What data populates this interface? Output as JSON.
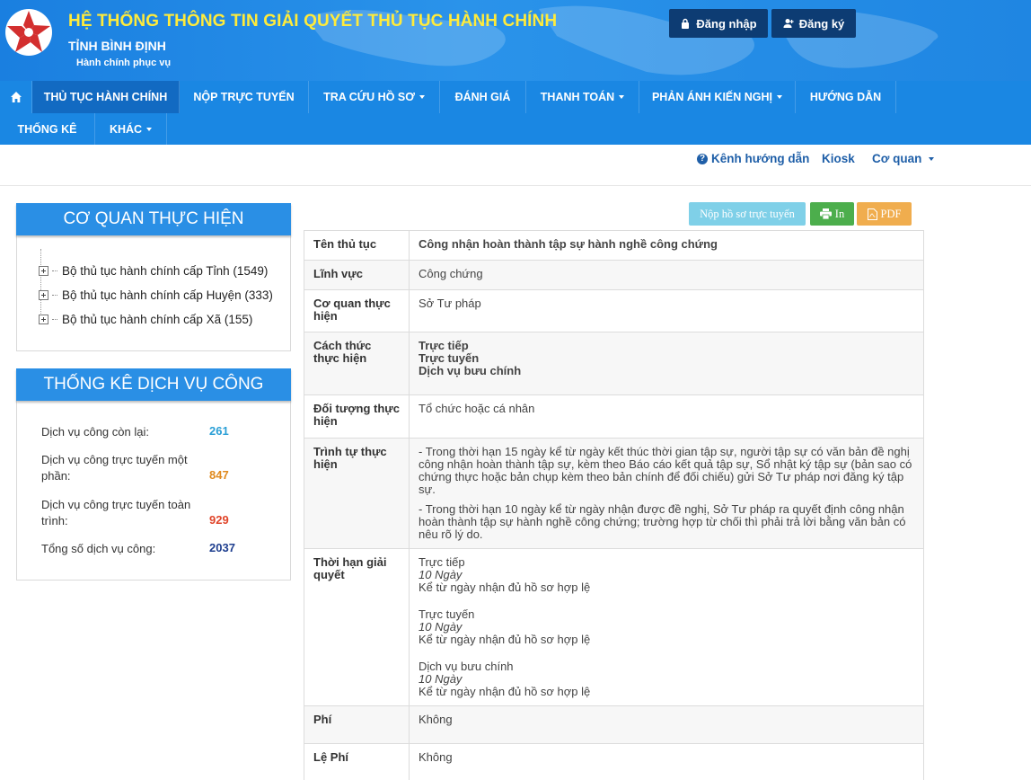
{
  "header": {
    "title": "HỆ THỐNG THÔNG TIN GIẢI QUYẾT THỦ TỤC HÀNH CHÍNH",
    "subtitle": "TỈNH BÌNH ĐỊNH",
    "slogan": "Hành chính phục vụ",
    "login_label": "Đăng nhập",
    "register_label": "Đăng ký"
  },
  "nav": {
    "items": [
      {
        "label": "THỦ TỤC HÀNH CHÍNH"
      },
      {
        "label": "NỘP TRỰC TUYẾN"
      },
      {
        "label": "TRA CỨU HỒ SƠ"
      },
      {
        "label": "ĐÁNH GIÁ"
      },
      {
        "label": "THANH TOÁN"
      },
      {
        "label": "PHẢN ÁNH KIẾN NGHỊ"
      },
      {
        "label": "HƯỚNG DẪN"
      },
      {
        "label": "THỐNG KÊ"
      },
      {
        "label": "KHÁC"
      }
    ]
  },
  "subnav": {
    "guide": "Kênh hướng dẫn",
    "kiosk": "Kiosk",
    "agency": "Cơ quan"
  },
  "agency_panel": {
    "title": "CƠ QUAN THỰC HIỆN",
    "items": [
      {
        "label": "Bộ thủ tục hành chính cấp Tỉnh (1549)"
      },
      {
        "label": "Bộ thủ tục hành chính cấp Huyện (333)"
      },
      {
        "label": "Bộ thủ tục hành chính cấp Xã (155)"
      }
    ]
  },
  "stats_panel": {
    "title": "THỐNG KÊ DỊCH VỤ CÔNG",
    "rows": [
      {
        "label": "Dịch vụ công còn lại:",
        "value": "261",
        "color": "#2a9fd6"
      },
      {
        "label": "Dịch vụ công trực tuyến một phần:",
        "value": "847",
        "color": "#e08a1e"
      },
      {
        "label": "Dịch vụ công trực tuyến toàn trình:",
        "value": "929",
        "color": "#e0452a"
      },
      {
        "label": "Tổng số dịch vụ công:",
        "value": "2037",
        "color": "#1f3f8f"
      }
    ]
  },
  "actions": {
    "submit": "Nộp hồ sơ trực tuyến",
    "print": "In",
    "pdf": "PDF"
  },
  "detail": {
    "name_label": "Tên thủ tục",
    "name_value": "Công nhận hoàn thành tập sự hành nghề công chứng",
    "field_label": "Lĩnh vực",
    "field_value": "Công chứng",
    "agency_label": "Cơ quan thực hiện",
    "agency_value": "Sở Tư pháp",
    "method_label": "Cách thức thực hiện",
    "method_values": [
      "Trực tiếp",
      "Trực tuyến",
      "Dịch vụ bưu chính"
    ],
    "target_label": "Đối tượng thực hiện",
    "target_value": "Tổ chức hoặc cá nhân",
    "process_label": "Trình tự thực hiện",
    "process_p1": "- Trong thời hạn 15 ngày kể từ ngày kết thúc thời gian tập sự, người tập sự có văn bản đề nghị công nhận hoàn thành tập sự, kèm theo Báo cáo kết quả tập sự, Sổ nhật ký tập sự (bản sao có chứng thực hoặc bản chụp kèm theo bản chính để đối chiếu) gửi Sở Tư pháp nơi đăng ký tập sự.",
    "process_p2": "- Trong thời hạn 10 ngày kể từ ngày nhận được đề nghị, Sở Tư pháp ra quyết định công nhận hoàn thành tập sự hành nghề công chứng; trường hợp từ chối thì phải trả lời bằng văn bản có nêu rõ lý do.",
    "deadline_label": "Thời hạn giải quyết",
    "deadlines": [
      {
        "method": "Trực tiếp",
        "time": "10 Ngày",
        "note": "Kể từ ngày nhận đủ hồ sơ hợp lệ"
      },
      {
        "method": "Trực tuyến",
        "time": "10 Ngày",
        "note": "Kể từ ngày nhận đủ hồ sơ hợp lệ"
      },
      {
        "method": "Dịch vụ bưu chính",
        "time": "10 Ngày",
        "note": "Kể từ ngày nhận đủ hồ sơ hợp lệ"
      }
    ],
    "fee_label": "Phí",
    "fee_value": "Không",
    "charge_label": "Lệ Phí",
    "charge_value": "Không"
  }
}
